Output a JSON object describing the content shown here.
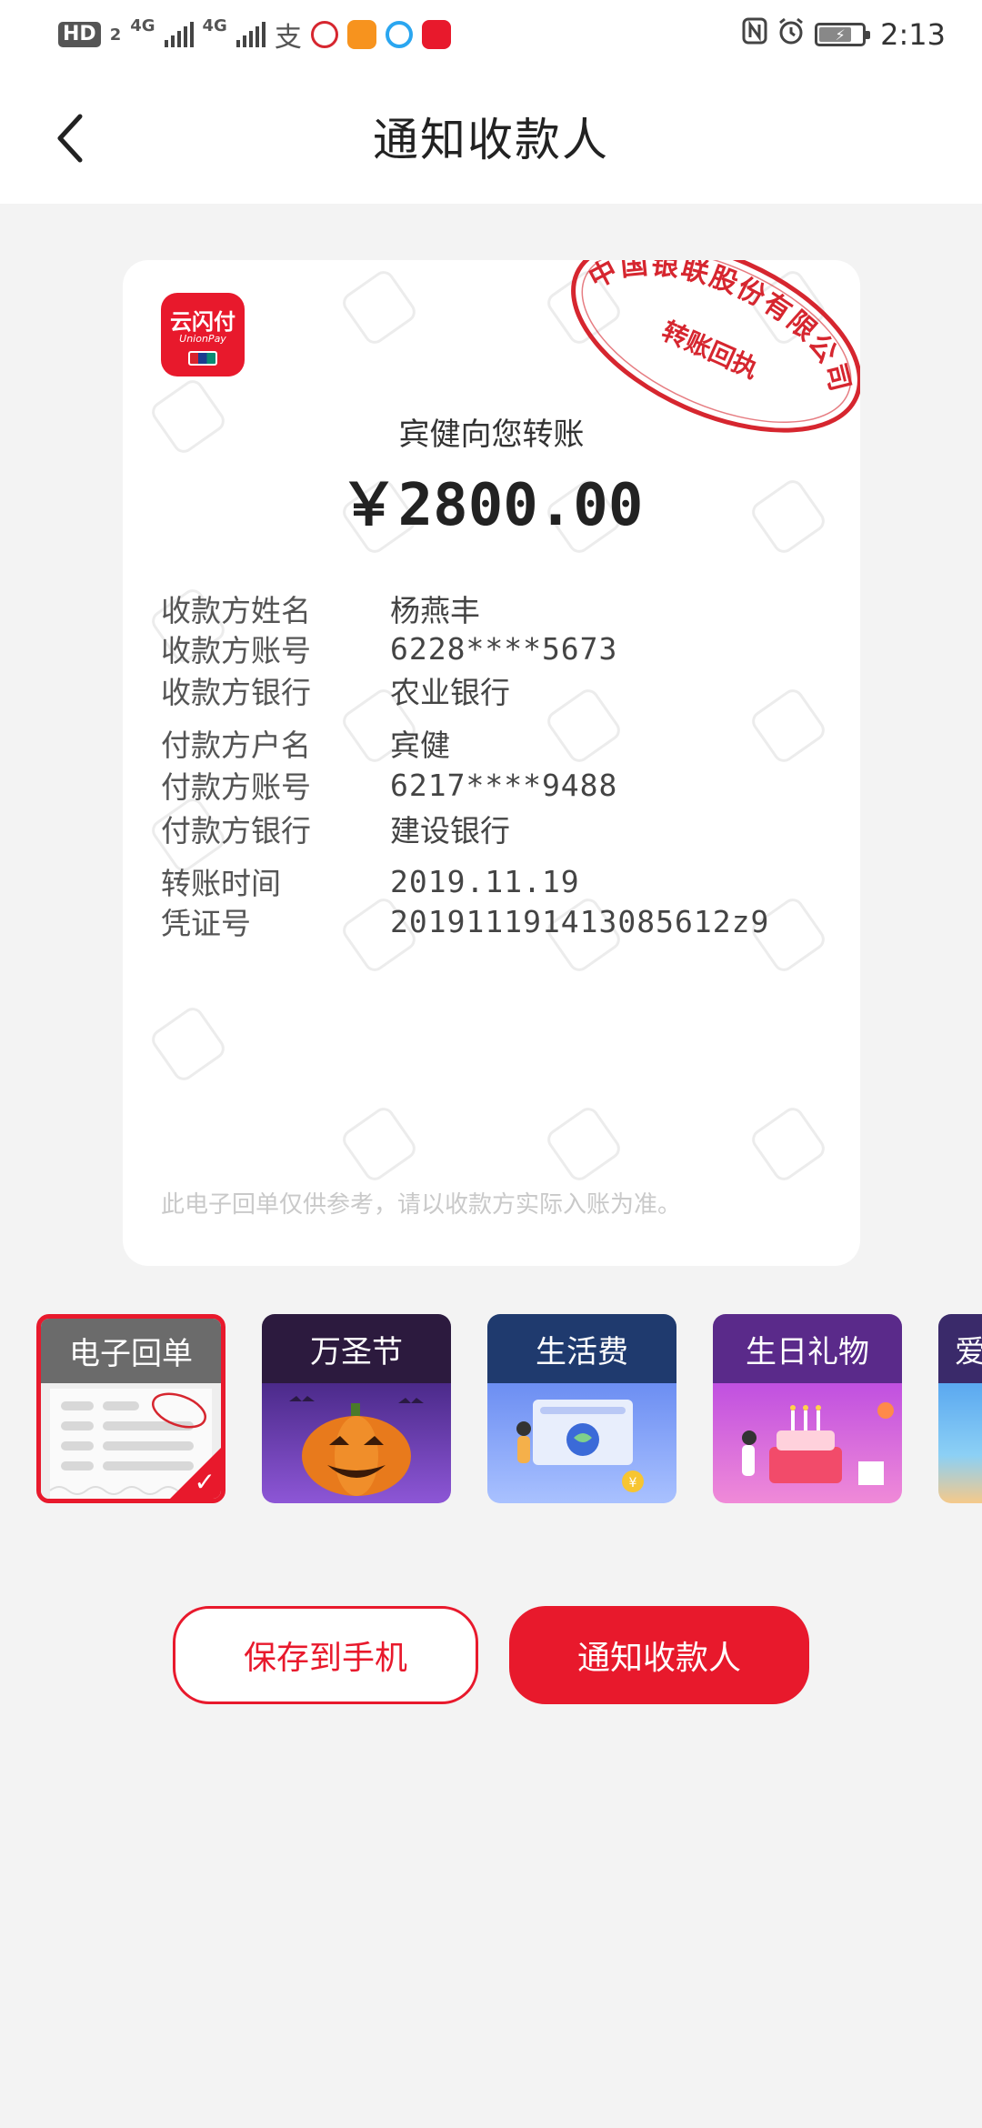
{
  "status_bar": {
    "hd": "HD",
    "sim_index": "2",
    "network1": "4G",
    "network2": "4G",
    "alipay_glyph": "支",
    "time": "2:13",
    "icons": [
      "nfc-icon",
      "alarm-icon",
      "battery-icon"
    ]
  },
  "nav": {
    "title": "通知收款人",
    "back_icon": "chevron-left-icon"
  },
  "receipt": {
    "logo_text": "云闪付",
    "logo_sub": "UnionPay",
    "stamp_line1": "中国银联股份有限公司",
    "stamp_line2": "转账回执",
    "greeting": "宾健向您转账",
    "amount": "￥2800.00",
    "rows": [
      {
        "label": "收款方姓名",
        "value": "杨燕丰"
      },
      {
        "label": "收款方账号",
        "value": "6228****5673"
      },
      {
        "label": "收款方银行",
        "value": "农业银行"
      },
      {
        "label": "付款方户名",
        "value": "宾健"
      },
      {
        "label": "付款方账号",
        "value": "6217****9488"
      },
      {
        "label": "付款方银行",
        "value": "建设银行"
      },
      {
        "label": "转账时间",
        "value": "2019.11.19"
      },
      {
        "label": "凭证号",
        "value": "201911191413085612z9"
      }
    ],
    "disclaimer": "此电子回单仅供参考，请以收款方实际入账为准。",
    "stamp_color": "#d6262f"
  },
  "templates": [
    {
      "label": "电子回单",
      "selected": true
    },
    {
      "label": "万圣节",
      "selected": false
    },
    {
      "label": "生活费",
      "selected": false
    },
    {
      "label": "生日礼物",
      "selected": false
    },
    {
      "label": "爱",
      "selected": false
    }
  ],
  "buttons": {
    "save": "保存到手机",
    "notify": "通知收款人"
  },
  "colors": {
    "accent": "#e8192c",
    "background": "#f3f3f3"
  }
}
